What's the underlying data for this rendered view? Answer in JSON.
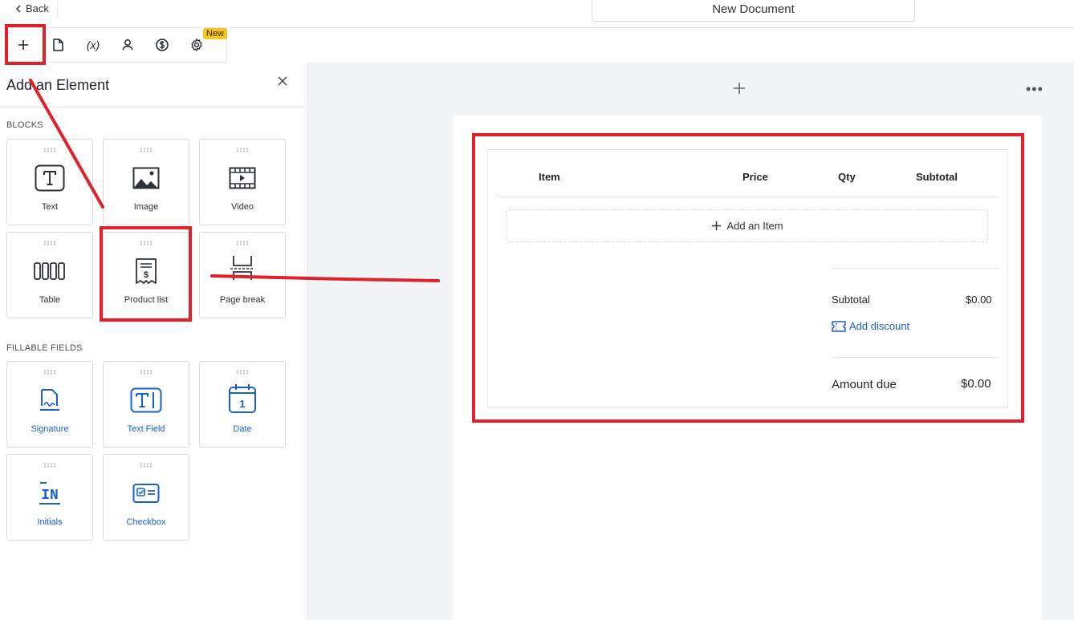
{
  "topbar": {
    "back_label": "Back",
    "document_title": "New Document"
  },
  "toolbar": {
    "buttons": [
      {
        "name": "plus-icon"
      },
      {
        "name": "document-icon"
      },
      {
        "name": "variable-icon",
        "label": "(x)"
      },
      {
        "name": "user-icon"
      },
      {
        "name": "dollar-icon"
      },
      {
        "name": "gear-icon"
      }
    ],
    "new_badge": "New"
  },
  "panel": {
    "title": "Add an Element",
    "blocks_heading": "BLOCKS",
    "blocks": [
      {
        "label": "Text",
        "icon": "text-icon"
      },
      {
        "label": "Image",
        "icon": "image-icon"
      },
      {
        "label": "Video",
        "icon": "video-icon"
      },
      {
        "label": "Table",
        "icon": "table-icon"
      },
      {
        "label": "Product list",
        "icon": "product-list-icon"
      },
      {
        "label": "Page break",
        "icon": "page-break-icon"
      }
    ],
    "fields_heading": "FILLABLE FIELDS",
    "fields": [
      {
        "label": "Signature",
        "icon": "signature-icon"
      },
      {
        "label": "Text Field",
        "icon": "text-field-icon"
      },
      {
        "label": "Date",
        "icon": "date-icon",
        "glyph": "1"
      },
      {
        "label": "Initials",
        "icon": "initials-icon",
        "glyph": "IN"
      },
      {
        "label": "Checkbox",
        "icon": "checkbox-icon"
      }
    ]
  },
  "product_list": {
    "columns": [
      "Item",
      "Price",
      "Qty",
      "Subtotal"
    ],
    "add_item_label": "Add an Item",
    "subtotal_label": "Subtotal",
    "subtotal_value": "$0.00",
    "add_discount_label": "Add discount",
    "amount_due_label": "Amount due",
    "amount_due_value": "$0.00"
  },
  "colors": {
    "accent_blue": "#1a5fd0",
    "annotation_red": "#e0202a",
    "badge_yellow": "#f5c518"
  }
}
